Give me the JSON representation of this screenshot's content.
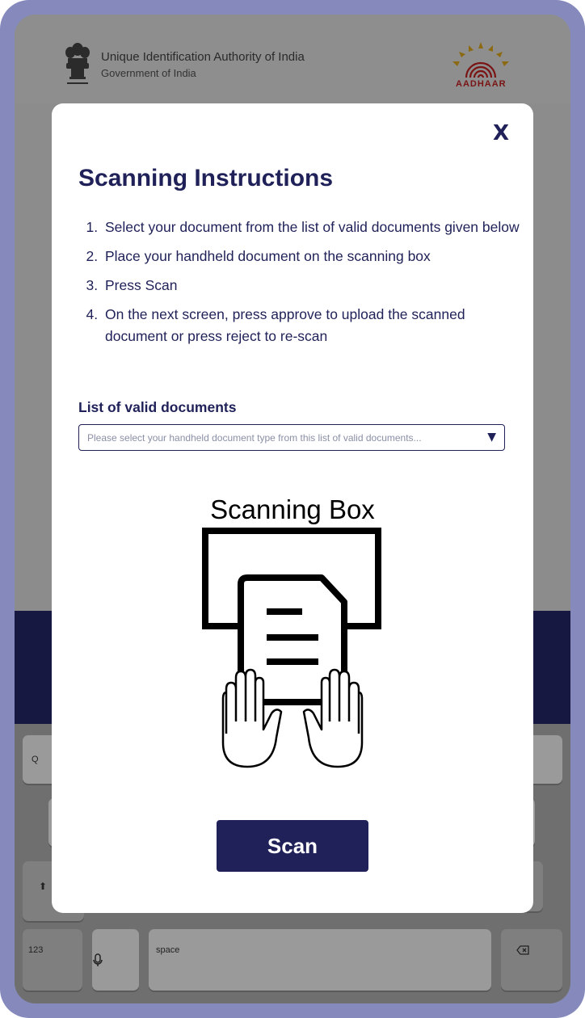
{
  "header": {
    "org_title": "Unique Identification Authority of India",
    "org_subtitle": "Government of India",
    "aadhaar_text": "AADHAAR"
  },
  "modal": {
    "close_label": "X",
    "title": "Scanning Instructions",
    "steps": [
      "Select your document from the list of valid documents given below",
      "Place your handheld document on the scanning box",
      "Press Scan",
      "On the next screen, press approve to upload the scanned document or press reject to re-scan"
    ],
    "documents_label": "List of valid documents",
    "documents_placeholder": "Please select your handheld document type from this list of valid documents...",
    "dropdown_icon": "triangle-down-icon",
    "scanning_box_title": "Scanning Box",
    "scan_button": "Scan"
  },
  "keyboard": {
    "q_key": "Q",
    "numbers_key": "123",
    "space_key": "space",
    "shift_icon": "shift-icon",
    "mic_icon": "microphone-icon",
    "backspace_icon": "backspace-icon"
  },
  "colors": {
    "accent": "#1f2158",
    "frame": "#8589bb",
    "navy_band": "#161842"
  }
}
